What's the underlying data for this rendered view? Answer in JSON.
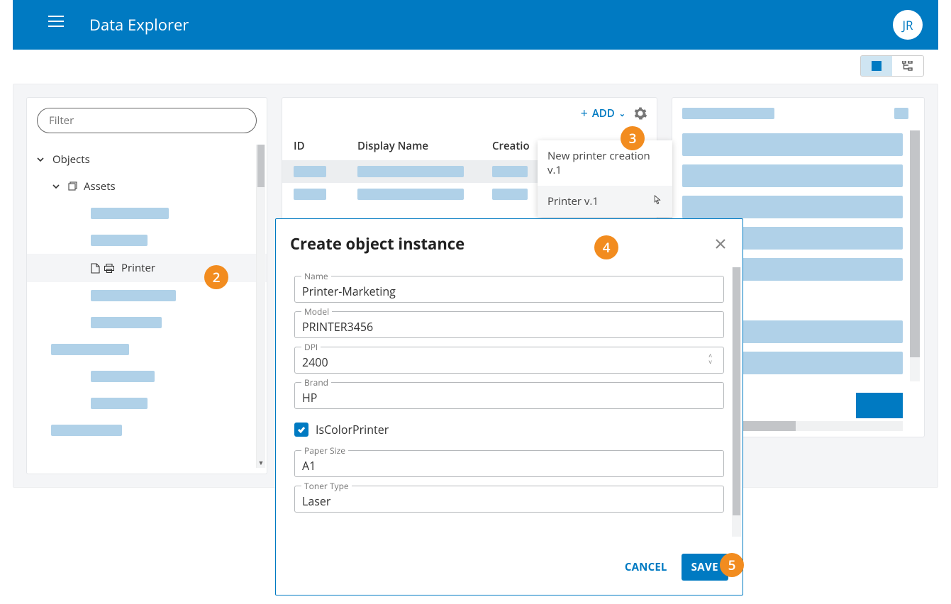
{
  "header": {
    "app_title": "Data Explorer",
    "avatar_initials": "JR"
  },
  "sidebar": {
    "filter_placeholder": "Filter",
    "root_label": "Objects",
    "assets_label": "Assets",
    "printer_label": "Printer"
  },
  "mid_panel": {
    "add_label": "ADD",
    "columns": {
      "id": "ID",
      "display_name": "Display Name",
      "creation": "Creatio"
    },
    "dropdown": {
      "item1": "New printer creation v.1",
      "item2": "Printer v.1"
    }
  },
  "modal": {
    "title": "Create object instance",
    "fields": {
      "name": {
        "label": "Name",
        "value": "Printer-Marketing"
      },
      "model": {
        "label": "Model",
        "value": "PRINTER3456"
      },
      "dpi": {
        "label": "DPI",
        "value": "2400"
      },
      "brand": {
        "label": "Brand",
        "value": "HP"
      },
      "is_color": {
        "label": "IsColorPrinter",
        "checked": true
      },
      "paper_size": {
        "label": "Paper Size",
        "value": "A1"
      },
      "toner_type": {
        "label": "Toner Type",
        "value": "Laser"
      }
    },
    "cancel_label": "CANCEL",
    "save_label": "SAVE"
  },
  "annotations": {
    "b2": "2",
    "b3": "3",
    "b4": "4",
    "b5": "5"
  }
}
